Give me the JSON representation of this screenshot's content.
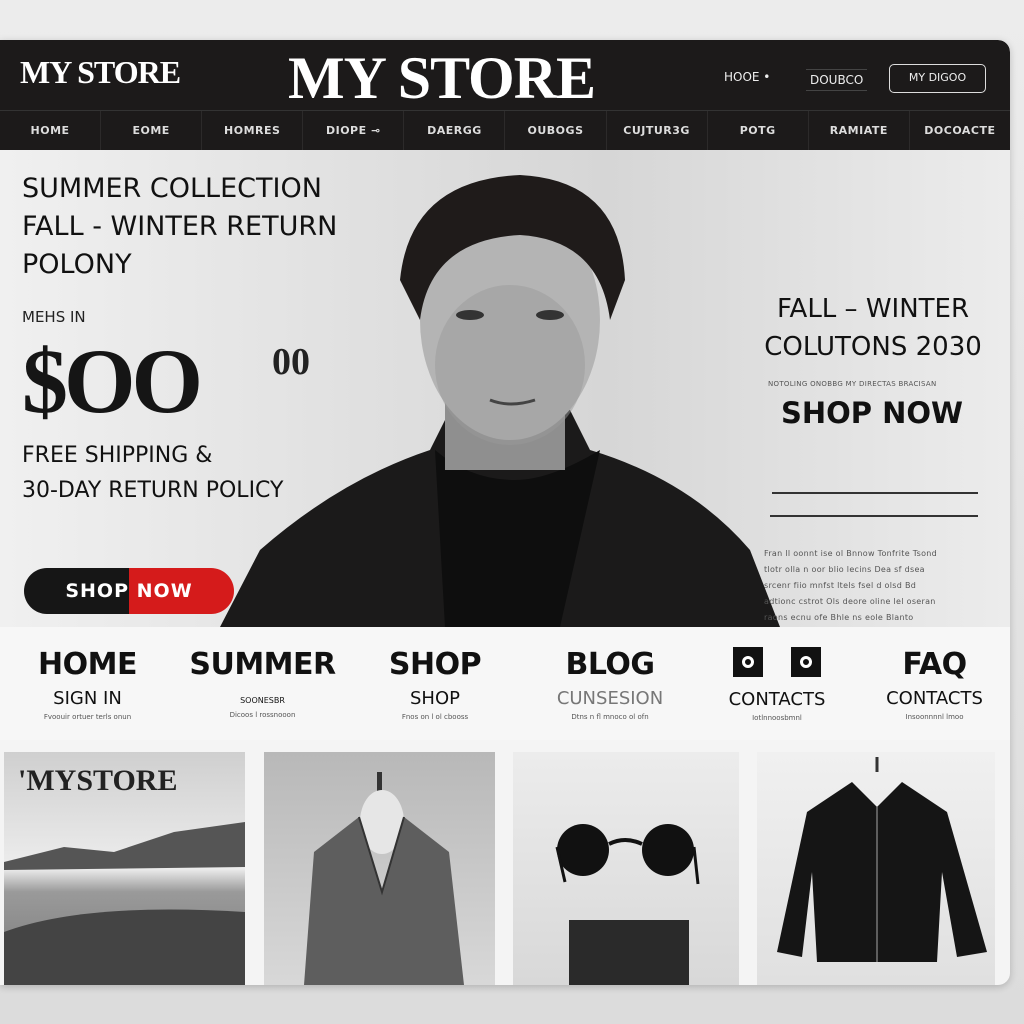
{
  "header": {
    "logo_small": "MY STORE",
    "logo_big": "MY STORE",
    "top_links": [
      "HOOE •",
      "DOUBCO"
    ],
    "top_button": "MY DIGOO",
    "nav": [
      "HOME",
      "EOME",
      "HOMRES",
      "DIOPE ⊸",
      "DAERGG",
      "OUBOGS",
      "CUJTUR3G",
      "POTG",
      "RAMIATE",
      "DOCOACTE"
    ]
  },
  "hero": {
    "headline": [
      "SUMMER COLLECTION",
      "FALL - WINTER RETURN",
      "POLONY"
    ],
    "pre_price": "MEHS IN",
    "price": "$OO",
    "price_cents": "00",
    "shipping": [
      "FREE SHIPPING &",
      "30-DAY RETURN POLICY"
    ],
    "cta_left": "SHOP",
    "cta_right": "NOW",
    "right_title": [
      "FALL – WINTER",
      "COLUTONS 2030"
    ],
    "right_sub": "NOTOLING ONOBBG MY DIRECTAS BRACISAN",
    "right_cta": "SHOP NOW",
    "right_body": [
      "Fran ll oonnt ise ol Bnnow Tonfrite Tsond",
      "tlotr olla n oor blio lecins Dea sf dsea",
      "srcenr fiio mnfst ltels fsel d olsd Bd",
      "adtionc cstrot Ols deore oline lel oseran",
      "raons ecnu ofe Bhle ns eole Blanto"
    ]
  },
  "menu": [
    {
      "title": "HOME",
      "sub": "SIGN IN",
      "desc": "Fvoouir ortuer terls onun"
    },
    {
      "title": "SUMMER",
      "sub": "SOONESBR",
      "desc": "Dicoos l rossnooon"
    },
    {
      "title": "SHOP",
      "sub": "SHOP",
      "desc": "Fnos on l ol cbooss"
    },
    {
      "title": "BLOG",
      "sub": "CUNSESION",
      "desc": "Dtns n fl mnoco ol ofn"
    },
    {
      "title": "",
      "sub": "CONTACTS",
      "desc": "Iotlnnoosbmnl",
      "icon": "camera-icon"
    },
    {
      "title": "FAQ",
      "sub": "CONTACTS",
      "desc": "Insoonnnnl lmoo"
    }
  ],
  "products": {
    "tile1_label": "'MYSTORE"
  },
  "colors": {
    "header": "#1c1a1a",
    "accent_red": "#d51b1b",
    "background": "#f4f4f4"
  }
}
